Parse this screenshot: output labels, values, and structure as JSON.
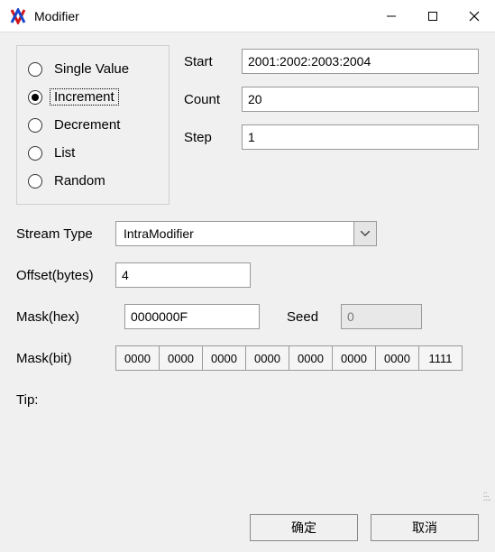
{
  "window": {
    "title": "Modifier"
  },
  "radios": {
    "single_value": "Single Value",
    "increment": "Increment",
    "decrement": "Decrement",
    "list": "List",
    "random": "Random"
  },
  "params": {
    "start_label": "Start",
    "start_value": "2001:2002:2003:2004",
    "count_label": "Count",
    "count_value": "20",
    "step_label": "Step",
    "step_value": "1"
  },
  "stream_type": {
    "label": "Stream Type",
    "value": "IntraModifier"
  },
  "offset": {
    "label": "Offset(bytes)",
    "value": "4"
  },
  "mask_hex": {
    "label": "Mask(hex)",
    "value": "0000000F"
  },
  "seed": {
    "label": "Seed",
    "value": "0"
  },
  "mask_bit": {
    "label": "Mask(bit)",
    "cells": [
      "0000",
      "0000",
      "0000",
      "0000",
      "0000",
      "0000",
      "0000",
      "1111"
    ]
  },
  "tip": {
    "label": "Tip:"
  },
  "buttons": {
    "ok": "确定",
    "cancel": "取消"
  }
}
